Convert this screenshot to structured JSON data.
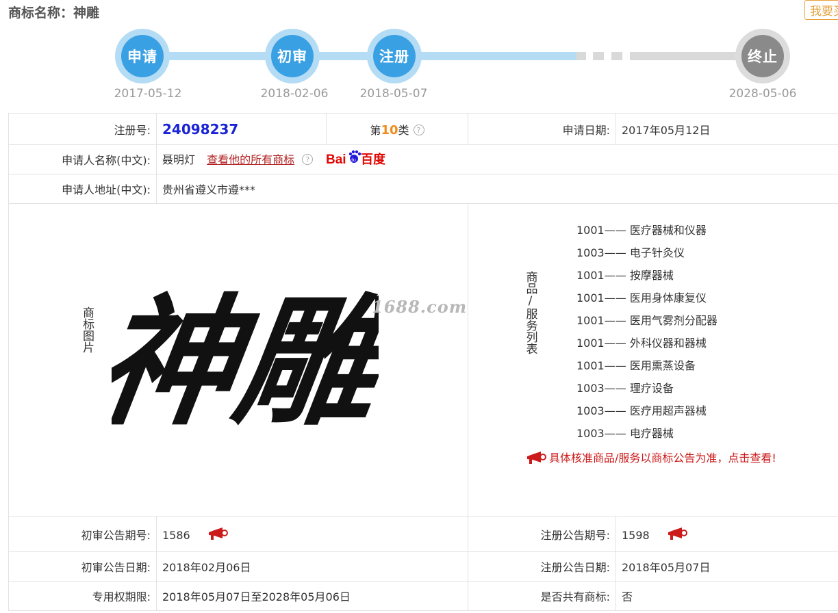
{
  "page_title": "商标名称：神雕",
  "top_right_button": "我要买",
  "timeline": [
    {
      "label": "申请",
      "date": "2017-05-12",
      "state": "done"
    },
    {
      "label": "初审",
      "date": "2018-02-06",
      "state": "done"
    },
    {
      "label": "注册",
      "date": "2018-05-07",
      "state": "done"
    },
    {
      "label": "终止",
      "date": "2028-05-06",
      "state": "future"
    }
  ],
  "info": {
    "reg_no_label": "注册号:",
    "reg_no": "24098237",
    "class_prefix": "第",
    "class_num": "10",
    "class_suffix": "类",
    "apply_date_label": "申请日期:",
    "apply_date": "2017年05月12日",
    "applicant_name_label": "申请人名称(中文):",
    "applicant_name": "聂明灯",
    "view_all_link": "查看他的所有商标",
    "applicant_addr_label": "申请人地址(中文):",
    "applicant_addr": "贵州省遵义市遵***",
    "mark_image_label": "商标图片",
    "mark_text": "神雕",
    "watermark": "1688.com",
    "goods_label": "商品/服务列表",
    "goods": [
      {
        "code": "1001——",
        "name": "医疗器械和仪器"
      },
      {
        "code": "1003——",
        "name": "电子针灸仪"
      },
      {
        "code": "1001——",
        "name": "按摩器械"
      },
      {
        "code": "1001——",
        "name": "医用身体康复仪"
      },
      {
        "code": "1001——",
        "name": "医用气雾剂分配器"
      },
      {
        "code": "1001——",
        "name": "外科仪器和器械"
      },
      {
        "code": "1001——",
        "name": "医用熏蒸设备"
      },
      {
        "code": "1003——",
        "name": "理疗设备"
      },
      {
        "code": "1003——",
        "name": "医疗用超声器械"
      },
      {
        "code": "1003——",
        "name": "电疗器械"
      }
    ],
    "goods_notice": "具体核准商品/服务以商标公告为准，点击查看!",
    "prelim_no_label": "初审公告期号:",
    "prelim_no": "1586",
    "reg_pub_no_label": "注册公告期号:",
    "reg_pub_no": "1598",
    "prelim_date_label": "初审公告日期:",
    "prelim_date": "2018年02月06日",
    "reg_pub_date_label": "注册公告日期:",
    "reg_pub_date": "2018年05月07日",
    "exclusive_label": "专用权期限:",
    "exclusive_period": "2018年05月07日至2028年05月06日",
    "shared_label": "是否共有商标:",
    "shared": "否"
  },
  "colors": {
    "accent_blue": "#3aa0e4",
    "reg_no_blue": "#1a24d4",
    "class_orange": "#f08c1c",
    "link_red": "#b22222"
  }
}
